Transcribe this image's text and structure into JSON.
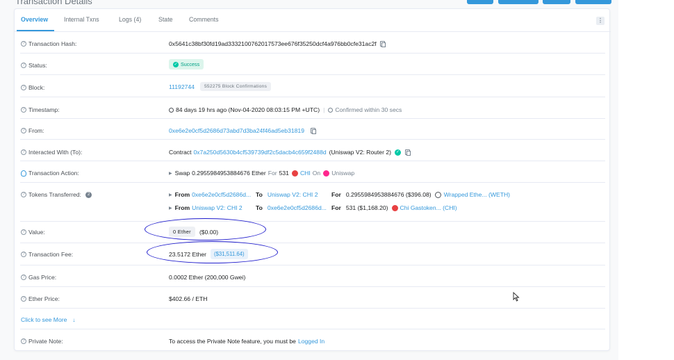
{
  "page": {
    "title": "Transaction Details"
  },
  "tabs": [
    {
      "label": "Overview"
    },
    {
      "label": "Internal Txns"
    },
    {
      "label": "Logs (4)"
    },
    {
      "label": "State"
    },
    {
      "label": "Comments"
    }
  ],
  "more_icon": "⋮",
  "rows": {
    "tx_hash": {
      "label": "Transaction Hash:",
      "value": "0x5641c38bf30fd19ad3332100762017573ee676f35250dcf4a976bb0cfe31ac2f"
    },
    "status": {
      "label": "Status:",
      "value": "Success"
    },
    "block": {
      "label": "Block:",
      "value": "11192744",
      "confirmations": "552275 Block Confirmations"
    },
    "timestamp": {
      "label": "Timestamp:",
      "value": "84 days 19 hrs ago (Nov-04-2020 08:03:15 PM +UTC)",
      "confirmed": "Confirmed within 30 secs"
    },
    "from": {
      "label": "From:",
      "value": "0xe6e2e0cf5d2686d73abd7d3ba24f46ad5eb31819"
    },
    "to": {
      "label": "Interacted With (To):",
      "prefix": "Contract",
      "address": "0x7a250d5630b4cf539739df2c5dacb4c659f2488d",
      "name": "(Uniswap V2: Router 2)"
    },
    "action": {
      "label": "Transaction Action:",
      "swap": "Swap",
      "amount": "0.2955984953884676 Ether",
      "for": "For",
      "qty": "531",
      "token": "CHI",
      "on": "On",
      "dex": "Uniswap"
    },
    "tokens": {
      "label": "Tokens Transferred:",
      "count": "2",
      "transfers": [
        {
          "from_label": "From",
          "from": "0xe6e2e0cf5d2686d...",
          "to_label": "To",
          "to": "Uniswap V2: CHI 2",
          "for_label": "For",
          "amount": "0.2955984953884676 ($396.08)",
          "token": "Wrapped Ethe... (WETH)"
        },
        {
          "from_label": "From",
          "from": "Uniswap V2: CHI 2",
          "to_label": "To",
          "to": "0xe6e2e0cf5d2686d...",
          "for_label": "For",
          "amount": "531 ($1,168.20)",
          "token": "Chi Gastoken... (CHI)"
        }
      ]
    },
    "value": {
      "label": "Value:",
      "ether": "0 Ether",
      "usd": "($0.00)"
    },
    "fee": {
      "label": "Transaction Fee:",
      "ether": "23.5172 Ether",
      "usd": "($31,511.64)"
    },
    "gas_price": {
      "label": "Gas Price:",
      "value": "0.0002 Ether (200,000 Gwei)"
    },
    "ether_price": {
      "label": "Ether Price:",
      "value": "$402.66 / ETH"
    },
    "see_more": {
      "label": "Click to see More",
      "icon": "↓"
    },
    "private_note": {
      "label": "Private Note:",
      "text": "To access the Private Note feature, you must be",
      "link": "Logged In"
    }
  },
  "help_icon": "?",
  "colors": {
    "accent": "#3498db",
    "success": "#00c9a7",
    "annotation": "#1e1bcc"
  }
}
